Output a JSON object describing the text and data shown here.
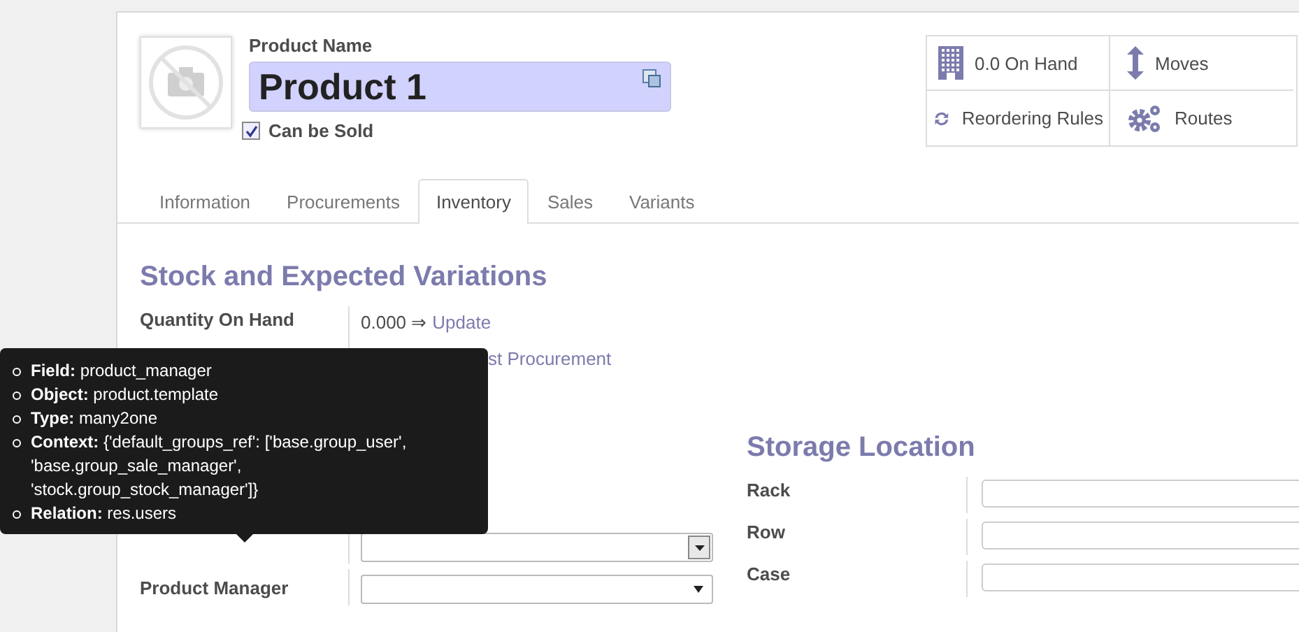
{
  "product": {
    "name_label": "Product Name",
    "name": "Product 1",
    "can_be_sold": {
      "label": "Can be Sold",
      "checked": true
    }
  },
  "stat_buttons": [
    {
      "kind": "building",
      "label": "0.0 On Hand"
    },
    {
      "kind": "updown",
      "label": "Moves"
    },
    {
      "kind": "refresh",
      "label": "Reordering Rules"
    },
    {
      "kind": "gears",
      "label": "Routes"
    }
  ],
  "tabs": [
    {
      "label": "Information",
      "selected": false
    },
    {
      "label": "Procurements",
      "selected": false
    },
    {
      "label": "Inventory",
      "selected": true
    },
    {
      "label": "Sales",
      "selected": false
    },
    {
      "label": "Variants",
      "selected": false
    }
  ],
  "stock_section": {
    "title": "Stock and Expected Variations",
    "rows": [
      {
        "label": "Quantity On Hand",
        "value": "0.000 ⇒",
        "link": "Update"
      },
      {
        "link_partial": "st Procurement"
      }
    ]
  },
  "other_fields": [
    {
      "kind": "select-button"
    },
    {
      "label": "Product Manager",
      "kind": "select"
    }
  ],
  "storage_section": {
    "title": "Storage Location",
    "fields": [
      "Rack",
      "Row",
      "Case"
    ]
  },
  "tooltip": {
    "items": [
      {
        "key": "Field:",
        "value": "product_manager"
      },
      {
        "key": "Object:",
        "value": "product.template"
      },
      {
        "key": "Type:",
        "value": "many2one"
      },
      {
        "key": "Context:",
        "value": "{'default_groups_ref': ['base.group_user', 'base.group_sale_manager', 'stock.group_stock_manager']}"
      },
      {
        "key": "Relation:",
        "value": "res.users"
      }
    ]
  }
}
